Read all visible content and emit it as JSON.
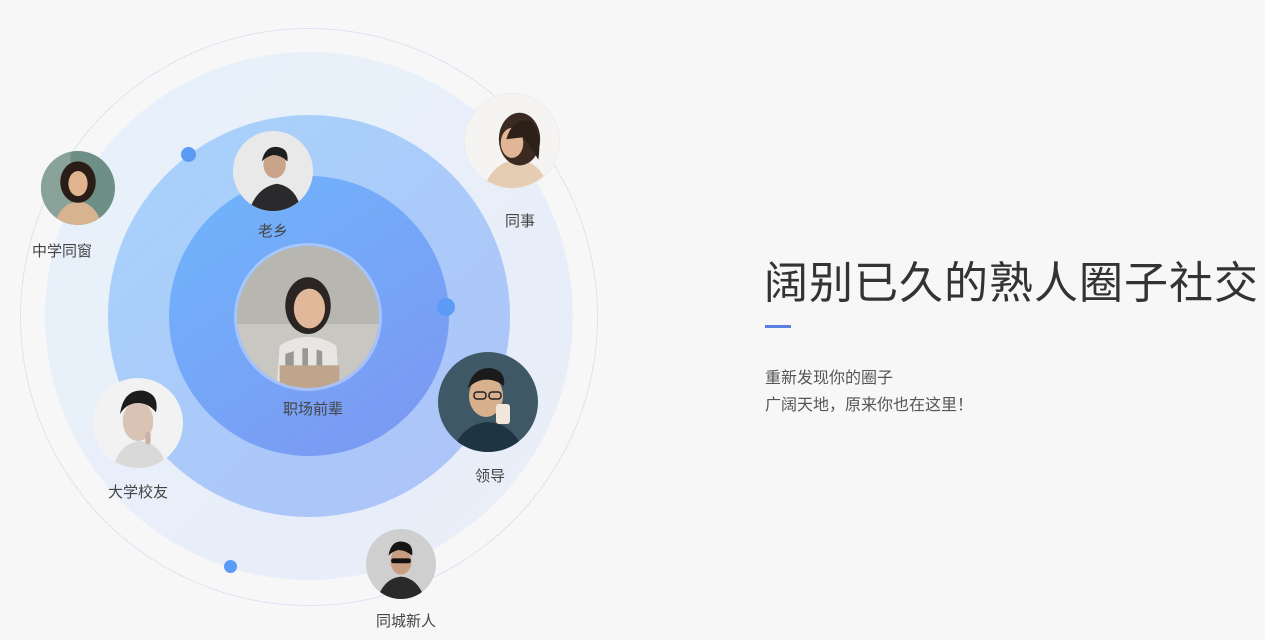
{
  "headline": "阔别已久的熟人圈子社交",
  "subtitle_line1": "重新发现你的圈子",
  "subtitle_line2": "广阔天地，原来你也在这里！",
  "labels": {
    "center": "职场前辈",
    "hometown": "老乡",
    "coworker": "同事",
    "middle_school": "中学同窗",
    "university": "大学校友",
    "leader": "领导",
    "new_in_city": "同城新人"
  },
  "colors": {
    "accent": "#5b7fe0",
    "dot": "#5b9bf6"
  }
}
